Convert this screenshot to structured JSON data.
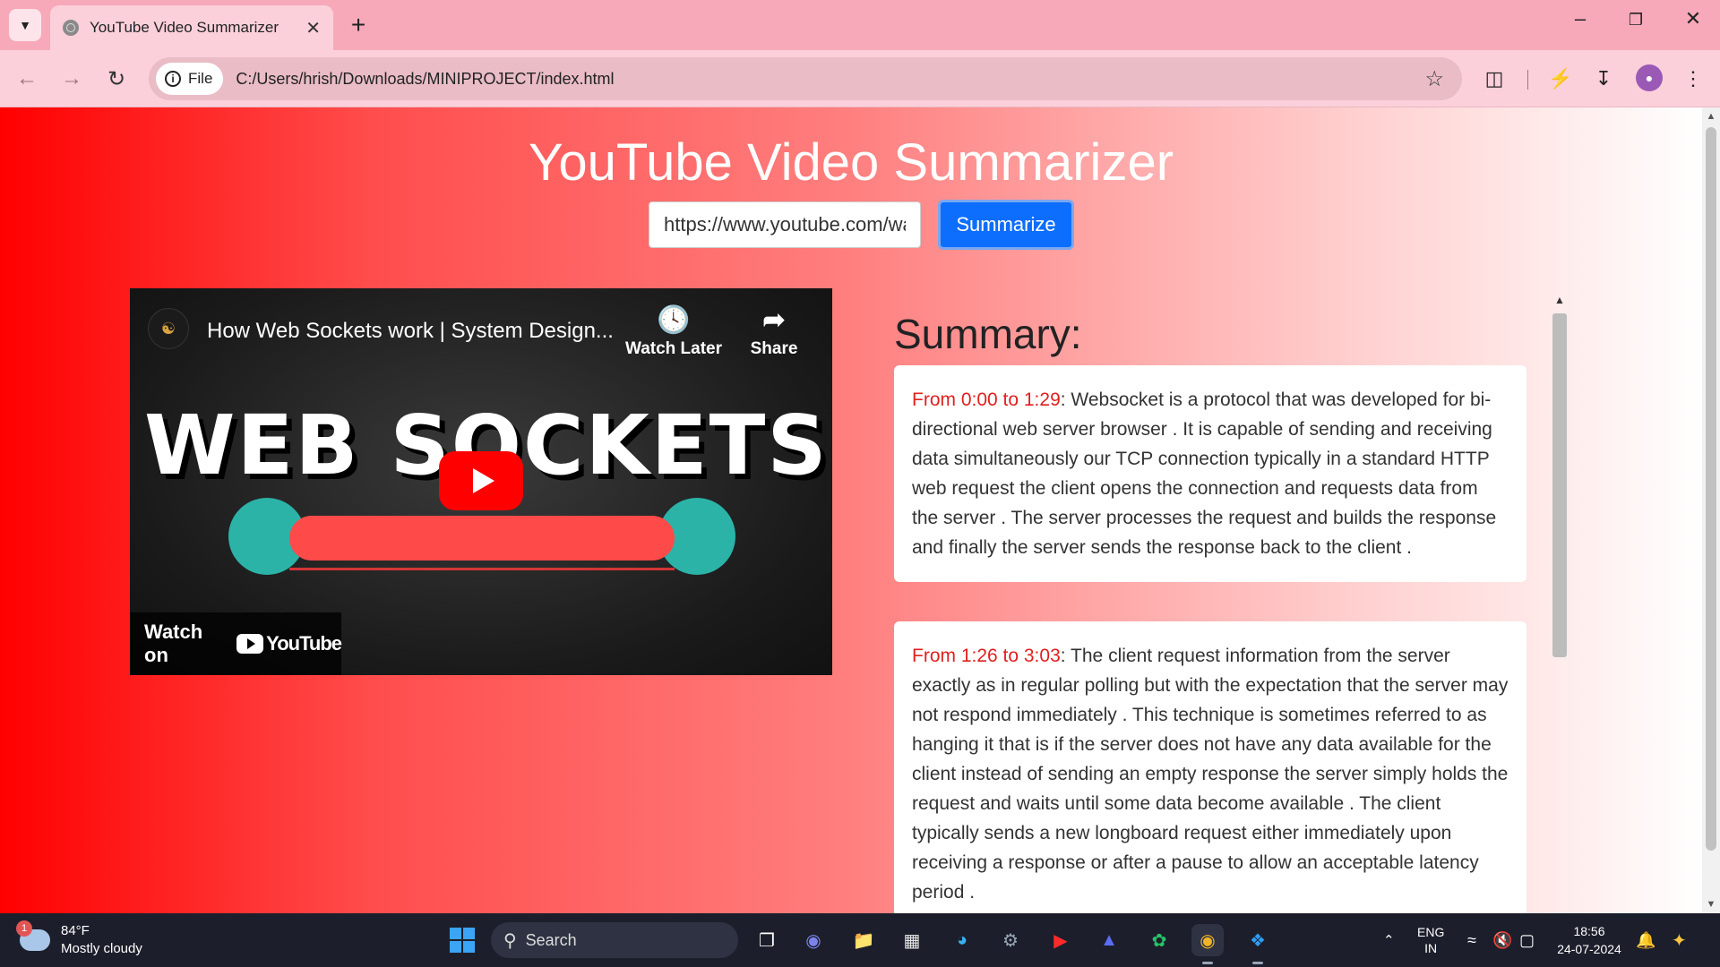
{
  "browser": {
    "tab_title": "YouTube Video Summarizer",
    "url_chip": "File",
    "url": "C:/Users/hrish/Downloads/MINIPROJECT/index.html"
  },
  "page": {
    "title": "YouTube Video Summarizer",
    "url_input_value": "https://www.youtube.com/watch",
    "summarize_label": "Summarize",
    "summary_heading": "Summary:"
  },
  "video": {
    "title": "How Web Sockets work | System Design...",
    "watch_later": "Watch Later",
    "share": "Share",
    "thumbnail_text": "WEB SOCKETS",
    "watch_on": "Watch on",
    "youtube": "YouTube"
  },
  "summaries": [
    {
      "timestamp": "From 0:00 to 1:29",
      "text": ": Websocket is a protocol that was developed for bi-directional web server browser . It is capable of sending and receiving data simultaneously our TCP connection typically in a standard HTTP web request the client opens the connection and requests data from the server . The server processes the request and builds the response and finally the server sends the response back to the client ."
    },
    {
      "timestamp": "From 1:26 to 3:03",
      "text": ": The client request information from the server exactly as in regular polling but with the expectation that the server may not respond immediately . This technique is sometimes referred to as hanging it that is if the server does not have any data available for the client instead of sending an empty response the server simply holds the request and waits until some data become available . The client typically sends a new longboard request either immediately upon receiving a response or after a pause to allow an acceptable latency period ."
    }
  ],
  "taskbar": {
    "weather_temp": "84°F",
    "weather_desc": "Mostly cloudy",
    "weather_badge": "1",
    "search_label": "Search",
    "lang_line1": "ENG",
    "lang_line2": "IN",
    "time": "18:56",
    "date": "24-07-2024"
  },
  "colors": {
    "accent_button": "#0d6efd",
    "timestamp": "#e02020",
    "gradient_start": "#ff0000",
    "gradient_end": "#ffffff"
  }
}
